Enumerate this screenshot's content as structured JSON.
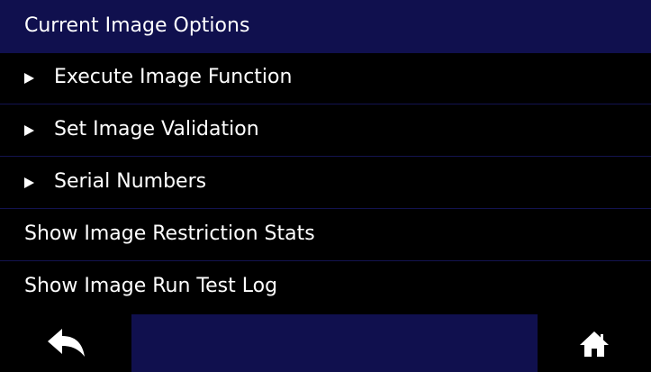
{
  "header": {
    "title": "Current Image Options"
  },
  "menu": {
    "items": [
      {
        "label": "Execute Image Function",
        "expandable": true
      },
      {
        "label": "Set Image Validation",
        "expandable": true
      },
      {
        "label": "Serial Numbers",
        "expandable": true
      },
      {
        "label": "Show Image Restriction Stats",
        "expandable": false
      },
      {
        "label": "Show Image Run Test Log",
        "expandable": false
      }
    ]
  },
  "footer": {
    "back_icon": "back-arrow-icon",
    "home_icon": "home-icon"
  },
  "colors": {
    "header_bg": "#10104e",
    "row_bg": "#000000",
    "divider": "#131350",
    "text": "#ffffff"
  }
}
